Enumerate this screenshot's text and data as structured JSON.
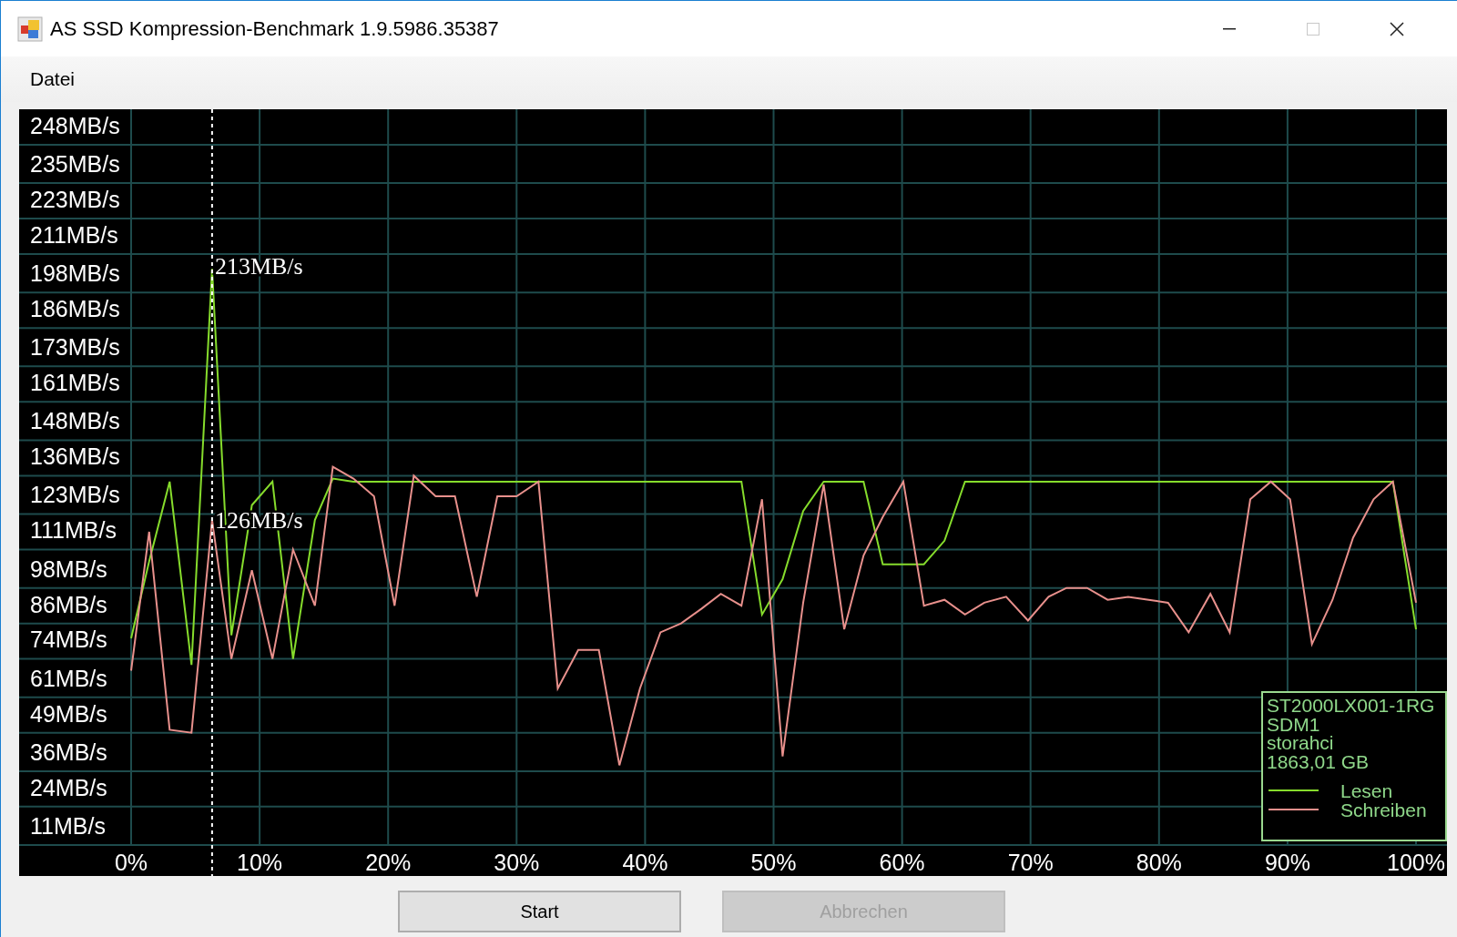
{
  "window": {
    "title": "AS SSD Kompression-Benchmark 1.9.5986.35387"
  },
  "window_buttons": [
    {
      "kind": "minimize",
      "disabled": false
    },
    {
      "kind": "maximize",
      "disabled": true
    },
    {
      "kind": "close",
      "disabled": false
    }
  ],
  "menu": [
    {
      "label": "Datei"
    }
  ],
  "chart": {
    "drive_info": [
      "ST2000LX001-1RG",
      "SDM1",
      "storahci",
      "1863,01 GB"
    ],
    "chart_data": {
      "type": "line",
      "x": [
        0,
        1.4,
        3.0,
        4.7,
        6.3,
        7.8,
        9.4,
        11.0,
        12.6,
        14.3,
        15.7,
        17.3,
        18.9,
        20.5,
        22.0,
        23.7,
        25.2,
        26.9,
        28.5,
        30.0,
        31.7,
        33.2,
        34.8,
        36.4,
        38.0,
        39.6,
        41.2,
        42.8,
        44.4,
        45.9,
        47.5,
        49.1,
        50.7,
        52.3,
        53.9,
        55.5,
        57.0,
        58.5,
        60.1,
        61.7,
        63.3,
        64.9,
        66.4,
        68.1,
        69.8,
        71.4,
        72.8,
        74.4,
        76.0,
        77.6,
        79.2,
        80.7,
        82.3,
        84.0,
        85.5,
        87.1,
        88.7,
        90.2,
        91.9,
        93.5,
        95.1,
        96.7,
        98.2,
        100
      ],
      "series": [
        {
          "name": "Lesen",
          "color": "#86dc2c",
          "values": [
            81,
            107,
            134,
            72,
            206,
            82,
            126,
            134,
            74,
            121,
            135,
            134,
            134,
            134,
            134,
            134,
            134,
            134,
            134,
            134,
            134,
            134,
            134,
            134,
            134,
            134,
            134,
            134,
            134,
            134,
            134,
            89,
            101,
            124,
            134,
            134,
            134,
            106,
            106,
            106,
            114,
            134,
            134,
            134,
            134,
            134,
            134,
            134,
            134,
            134,
            134,
            134,
            134,
            134,
            134,
            134,
            134,
            134,
            134,
            134,
            134,
            134,
            134,
            84
          ]
        },
        {
          "name": "Schreiben",
          "color": "#e8908c",
          "values": [
            70,
            117,
            50,
            49,
            121,
            74,
            104,
            74,
            111,
            92,
            139,
            135,
            129,
            92,
            136,
            129,
            129,
            95,
            129,
            129,
            134,
            64,
            77,
            77,
            38,
            64,
            83,
            86,
            91,
            96,
            92,
            128,
            41,
            93,
            133,
            84,
            109,
            122,
            134,
            92,
            94,
            89,
            93,
            95,
            87,
            95,
            98,
            98,
            94,
            95,
            94,
            93,
            83,
            96,
            83,
            128,
            134,
            128,
            79,
            94,
            115,
            128,
            134,
            93
          ]
        }
      ],
      "xlim": [
        0,
        100
      ],
      "ylim": [
        11,
        260
      ],
      "grid": true,
      "legend": true,
      "xticks": [
        {
          "value": 0,
          "label": "0%"
        },
        {
          "value": 10,
          "label": "10%"
        },
        {
          "value": 20,
          "label": "20%"
        },
        {
          "value": 30,
          "label": "30%"
        },
        {
          "value": 40,
          "label": "40%"
        },
        {
          "value": 50,
          "label": "50%"
        },
        {
          "value": 60,
          "label": "60%"
        },
        {
          "value": 70,
          "label": "70%"
        },
        {
          "value": 80,
          "label": "80%"
        },
        {
          "value": 90,
          "label": "90%"
        },
        {
          "value": 100,
          "label": "100%"
        }
      ],
      "yticks": [
        {
          "value": 248,
          "label": "248MB/s"
        },
        {
          "value": 235,
          "label": "235MB/s"
        },
        {
          "value": 223,
          "label": "223MB/s"
        },
        {
          "value": 211,
          "label": "211MB/s"
        },
        {
          "value": 198,
          "label": "198MB/s"
        },
        {
          "value": 186,
          "label": "186MB/s"
        },
        {
          "value": 173,
          "label": "173MB/s"
        },
        {
          "value": 161,
          "label": "161MB/s"
        },
        {
          "value": 148,
          "label": "148MB/s"
        },
        {
          "value": 136,
          "label": "136MB/s"
        },
        {
          "value": 123,
          "label": "123MB/s"
        },
        {
          "value": 111,
          "label": "111MB/s"
        },
        {
          "value": 98,
          "label": "98MB/s"
        },
        {
          "value": 86,
          "label": "86MB/s"
        },
        {
          "value": 74,
          "label": "74MB/s"
        },
        {
          "value": 61,
          "label": "61MB/s"
        },
        {
          "value": 49,
          "label": "49MB/s"
        },
        {
          "value": 36,
          "label": "36MB/s"
        },
        {
          "value": 24,
          "label": "24MB/s"
        },
        {
          "value": 11,
          "label": "11MB/s"
        }
      ],
      "ref_lines": [
        {
          "axis": "x",
          "value": 6.3
        }
      ],
      "annotations": [
        {
          "x": 6.3,
          "y": 207,
          "text": "213MB/s"
        },
        {
          "x": 6.3,
          "y": 121,
          "text": "126MB/s"
        }
      ]
    }
  },
  "buttons": [
    {
      "label": "Start",
      "disabled": false
    },
    {
      "label": "Abbrechen",
      "disabled": true
    }
  ]
}
